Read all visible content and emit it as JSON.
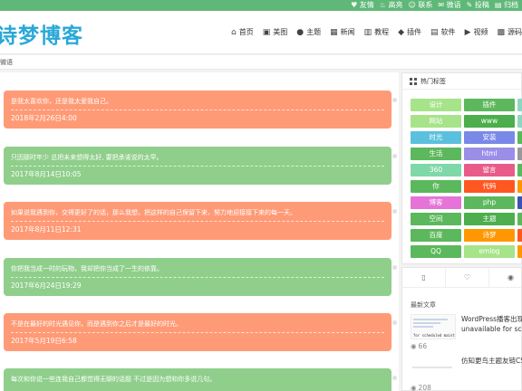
{
  "topbar": {
    "links": [
      "友情",
      "高亮",
      "联系",
      "微语",
      "投稿",
      "归档"
    ],
    "icons": [
      "heart-icon",
      "idea-icon",
      "user-icon",
      "chat-icon",
      "edit-icon",
      "archive-icon"
    ]
  },
  "header": {
    "logo": "诗梦博客",
    "nav": [
      {
        "label": "首页",
        "icon": "home-icon"
      },
      {
        "label": "美图",
        "icon": "image-icon"
      },
      {
        "label": "主题",
        "icon": "palette-icon"
      },
      {
        "label": "新闻",
        "icon": "news-icon"
      },
      {
        "label": "教程",
        "icon": "book-icon"
      },
      {
        "label": "插件",
        "icon": "plug-icon"
      },
      {
        "label": "软件",
        "icon": "app-icon"
      },
      {
        "label": "视频",
        "icon": "video-icon"
      },
      {
        "label": "源码",
        "icon": "code-icon"
      }
    ]
  },
  "breadcrumb": {
    "current": "微语"
  },
  "posts": [
    {
      "text": "是我太喜欢你，还是我太爱我自己。",
      "date": "2018年2月26日4:00",
      "color": "#ff9a76"
    },
    {
      "text": "只因那时年少 总把未来想得太好, 要把承诺说的太早。",
      "date": "2017年8月14日10:05",
      "color": "#8fcf8b"
    },
    {
      "text": "如果说我遇到你，交得更好了的话，那么我想，把这样的自己保留下来，努力地迎接接下来的每一天。",
      "date": "2017年8月11日12:31",
      "color": "#ff9a76"
    },
    {
      "text": "你把我当成一时的玩物，我却把你当成了一生的依靠。",
      "date": "2017年6月24日19:29",
      "color": "#8fcf8b"
    },
    {
      "text": "不是在最好的时光遇见你，而是遇到你之后才是最好的时光。",
      "date": "2017年5月19日6:58",
      "color": "#ff9a76"
    },
    {
      "text": "每次和你说一些连我自己都觉得无聊的话题 不过是因为想和你多说几句。",
      "date": "",
      "color": "#8fcf8b"
    }
  ],
  "sidebar": {
    "tags_title": "热门标签",
    "tags": [
      {
        "label": "设计",
        "color": "#a6e389"
      },
      {
        "label": "插件",
        "color": "#5cb85c"
      },
      {
        "label": "",
        "color": "#8fd6c0"
      },
      {
        "label": "网站",
        "color": "#a6e389"
      },
      {
        "label": "www",
        "color": "#4cae4c"
      },
      {
        "label": "",
        "color": "#8fd6c0"
      },
      {
        "label": "时光",
        "color": "#5bc0de"
      },
      {
        "label": "安装",
        "color": "#7a89e8"
      },
      {
        "label": "",
        "color": "#5cb85c"
      },
      {
        "label": "生活",
        "color": "#5cb85c"
      },
      {
        "label": "html",
        "color": "#9b8ee8"
      },
      {
        "label": "",
        "color": "#999999"
      },
      {
        "label": "360",
        "color": "#7fd8a8"
      },
      {
        "label": "留言",
        "color": "#e85c8a"
      },
      {
        "label": "",
        "color": "#5cb85c"
      },
      {
        "label": "你",
        "color": "#5cb85c"
      },
      {
        "label": "代码",
        "color": "#ff5722"
      },
      {
        "label": "",
        "color": "#ff9800"
      },
      {
        "label": "博客",
        "color": "#e573d8"
      },
      {
        "label": "php",
        "color": "#5cb85c"
      },
      {
        "label": "",
        "color": "#3f51b5"
      },
      {
        "label": "空间",
        "color": "#5cb85c"
      },
      {
        "label": "主题",
        "color": "#4cae4c"
      },
      {
        "label": "",
        "color": "#5cb85c"
      },
      {
        "label": "百度",
        "color": "#5cb85c"
      },
      {
        "label": "诗梦",
        "color": "#ff9800"
      },
      {
        "label": "",
        "color": "#ff5722"
      },
      {
        "label": "QQ",
        "color": "#5cb85c"
      },
      {
        "label": "emlog",
        "color": "#a6e389"
      },
      {
        "label": "",
        "color": "#ff9800"
      }
    ],
    "tabs": [
      {
        "icon": "document-icon",
        "label": "▯"
      },
      {
        "icon": "heart-icon",
        "label": "♡"
      },
      {
        "icon": "eye-icon",
        "label": "◉"
      }
    ],
    "recent_title": "最新文章",
    "recent": [
      {
        "title_line1": "WordPress播客出现",
        "title_line2": "unavailable for sch",
        "views": "66",
        "thumb_text": "for scheduled maint"
      },
      {
        "title_line1": "仿知更鸟主题友链CS",
        "title_line2": "",
        "views": "208",
        "thumb_text": ""
      }
    ]
  }
}
